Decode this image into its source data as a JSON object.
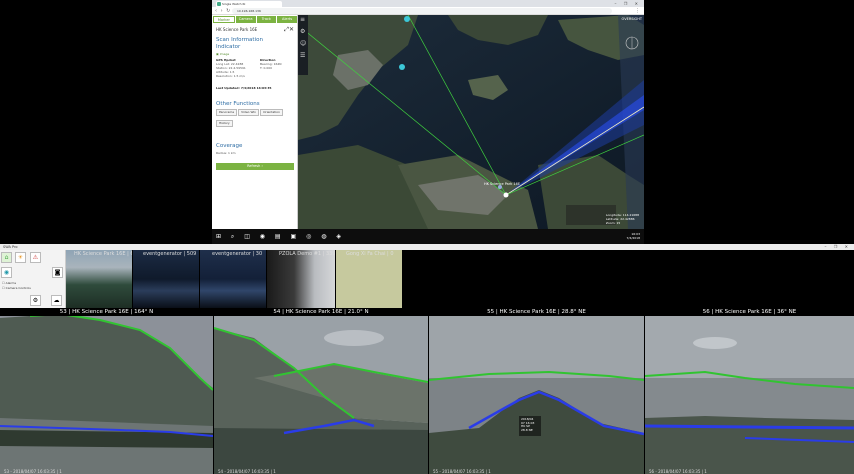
{
  "browser": {
    "tab_title": "Single Watch Ri",
    "url": "10.196.168.136",
    "window_controls": "–  ❐  ✕"
  },
  "panel": {
    "tabs": [
      "Marker",
      "Camera",
      "Track",
      "Alerts"
    ],
    "location_title": "HK Science Park 16E",
    "heading_scan": "Scan Information",
    "heading_indicator": "Indicator",
    "image_link": "Image",
    "gps_label": "GPS Hpcket",
    "long_label": "Long Lat: 22.4288",
    "station_label": "Station: 22.4.59591",
    "altitude_label": "Altitude: 1.5",
    "resolution_label": "Resolution: 1.5 m/s",
    "direction_label": "Direction",
    "bearing_label": "Bearing: 164N",
    "tilt_label": "T: 0.000",
    "last_updated": "Last Updated: 7/4/2018 16:03:35",
    "heading_other": "Other Functions",
    "buttons": [
      "Panorama",
      "Video Win",
      "Orientation"
    ],
    "button_extra": "History",
    "heading_coverage": "Coverage",
    "coverage_radius": "Radius:  1 km",
    "submit_label": "Refresh"
  },
  "map": {
    "logo_text": "OVERSIGHT",
    "marker_label": "HK Science Park 16E",
    "info_longitude": "Longitude: 114.21688",
    "info_latitude": "Latitude: 22.42886",
    "info_zoom": "Zoom: 15"
  },
  "taskbar": {
    "time": "16:03",
    "date": "7/4/2018"
  },
  "vms": {
    "title": "SWA Pro",
    "thumbs": [
      {
        "label": "HK Science Park 16E | 60"
      },
      {
        "label": "eventgenerator | 509"
      },
      {
        "label": "eventgenerator | 30"
      },
      {
        "label": "PZOLA Demo #1 | 339"
      },
      {
        "label": "Gong Xi Fa Chai | 0"
      }
    ],
    "controls": {
      "chk1": "Alarms",
      "chk2": "Camera Controls"
    },
    "feeds": [
      {
        "label": "53 | HK Science Park 16E | 164° N",
        "timestamp": "53 - 2018/04/07 16:03:35 | 1"
      },
      {
        "label": "54 | HK Science Park 16E | 21.0° N",
        "timestamp": "54 - 2018/04/07 16:03:35 | 1"
      },
      {
        "label": "55 | HK Science Park 16E | 28.8° NE",
        "timestamp": "55 - 2018/04/07 16:03:35 | 1"
      },
      {
        "label": "56 | HK Science Park 16E | 36° NE",
        "timestamp": "56 - 2018/04/07 16:03:35 | 1"
      }
    ]
  }
}
